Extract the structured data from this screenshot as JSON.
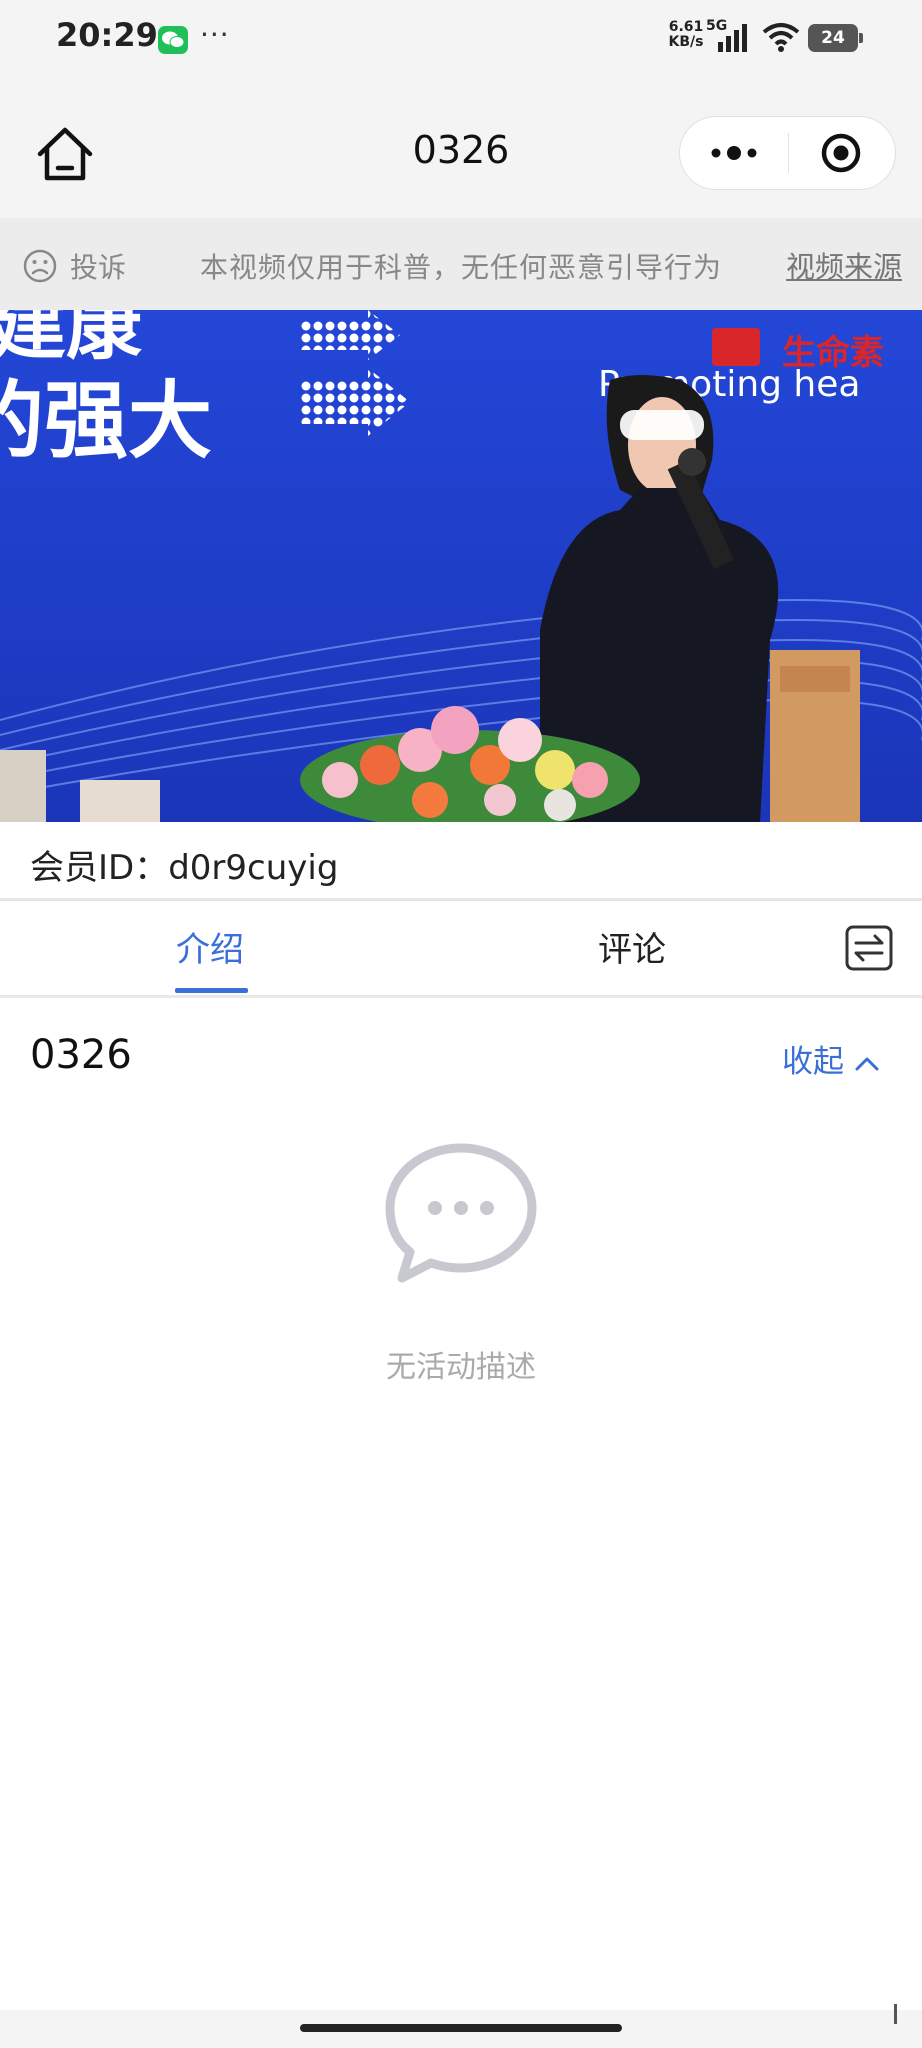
{
  "status_bar": {
    "time": "20:29",
    "more": "···",
    "net_speed_value": "6.61",
    "net_speed_unit": "KB/s",
    "network": "5G",
    "battery": "24"
  },
  "nav": {
    "title": "0326"
  },
  "notice": {
    "complain_label": "投诉",
    "text": "本视频仅用于科普，无任何恶意引导行为",
    "source_label": "视频来源"
  },
  "video": {
    "backdrop_text_1": "建康",
    "backdrop_text_2": "的强大",
    "brand": "生命素",
    "slogan": "Promoting hea"
  },
  "member": {
    "label": "会员ID：d0r9cuyig"
  },
  "tabs": [
    {
      "label": "介绍",
      "active": true
    },
    {
      "label": "评论",
      "active": false
    }
  ],
  "content": {
    "title": "0326",
    "collapse_label": "收起",
    "empty_text": "无活动描述"
  },
  "colors": {
    "accent": "#3a6fd8",
    "video_bg": "#1e3fd0"
  }
}
